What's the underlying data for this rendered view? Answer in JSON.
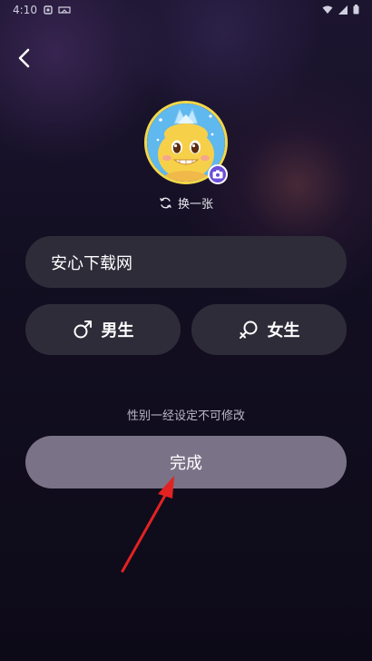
{
  "status_bar": {
    "time": "4:10"
  },
  "avatar": {
    "change_label": "换一张"
  },
  "nickname": {
    "value": "安心下载网"
  },
  "gender": {
    "male_label": "男生",
    "female_label": "女生"
  },
  "hint": "性别一经设定不可修改",
  "done_button": {
    "label": "完成"
  },
  "colors": {
    "accent": "#6b4fd8",
    "avatar_border": "#f3d84a",
    "annotation_arrow": "#e32222"
  },
  "icons": [
    "back-icon",
    "camera-icon",
    "refresh-icon",
    "male-icon",
    "female-icon"
  ]
}
